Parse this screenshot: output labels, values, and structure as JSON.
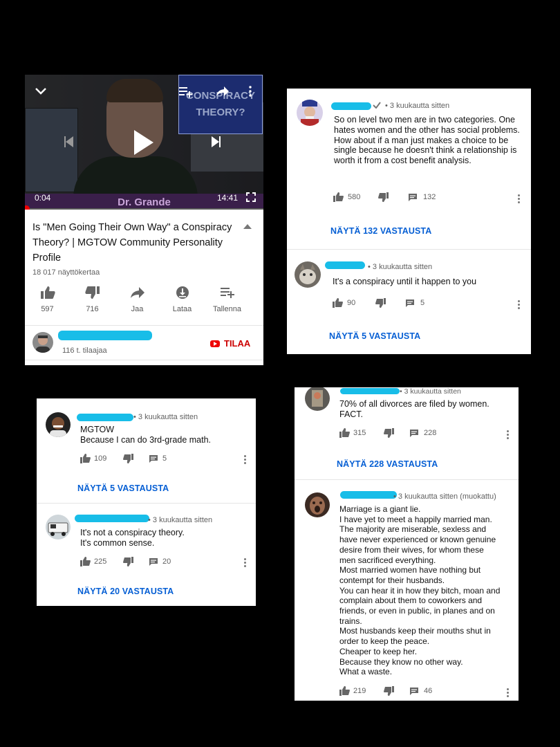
{
  "video": {
    "overlay_text": "CONSPIRACY THEORY?",
    "current_time": "0:04",
    "duration": "14:41",
    "brand": "Dr. Grande",
    "progress": 0.005,
    "title": "Is \"Men Going Their Own Way\" a Conspiracy Theory? | MGTOW Community Personality Profile",
    "views": "18 017 näyttökertaa",
    "actions": [
      {
        "label": "597",
        "icon": "thumbs-up-icon"
      },
      {
        "label": "716",
        "icon": "thumbs-down-icon"
      },
      {
        "label": "Jaa",
        "icon": "share-icon"
      },
      {
        "label": "Lataa",
        "icon": "download-icon"
      },
      {
        "label": "Tallenna",
        "icon": "playlist-add-icon"
      }
    ],
    "channel": {
      "subscribers": "116 t. tilaajaa",
      "subscribe_label": "TILAA"
    }
  },
  "comments": [
    {
      "time": "• 3 kuukautta sitten",
      "text": "So on level two men are in two categories. One hates women and the other has social problems. How about if a man just makes a choice to be single because he doesn't think a relationship is worth it from a cost benefit analysis.",
      "likes": "580",
      "reply_count": "132",
      "replies_label": "NÄYTÄ 132 VASTAUSTA"
    },
    {
      "time": "• 3 kuukautta sitten",
      "text": "It's a conspiracy until it happen to you",
      "likes": "90",
      "reply_count": "5",
      "replies_label": "NÄYTÄ 5 VASTAUSTA"
    },
    {
      "time": "• 3 kuukautta sitten",
      "text_lines": [
        "MGTOW",
        "Because I can do 3rd-grade math."
      ],
      "likes": "109",
      "reply_count": "5",
      "replies_label": "NÄYTÄ 5 VASTAUSTA"
    },
    {
      "time": "• 3 kuukautta sitten",
      "text_lines": [
        "It's not a conspiracy theory.",
        "It's common sense."
      ],
      "likes": "225",
      "reply_count": "20",
      "replies_label": "NÄYTÄ 20 VASTAUSTA"
    },
    {
      "time": "• 3 kuukautta sitten",
      "text_lines": [
        "70% of all divorces are filed by women.",
        "FACT."
      ],
      "likes": "315",
      "reply_count": "228",
      "replies_label": "NÄYTÄ 228 VASTAUSTA"
    },
    {
      "time": "• 3 kuukautta sitten (muokattu)",
      "text_lines": [
        "Marriage is a giant lie.",
        "I have yet to meet a happily married man.",
        "The majority are miserable, sexless and",
        "have never experienced or known genuine",
        "desire from their wives, for whom these",
        "men sacrificed everything.",
        "Most married women have nothing but",
        "contempt for their husbands.",
        "You can hear it in how they bitch, moan and",
        "complain about them to coworkers and",
        "friends, or even in public, in planes and on",
        "trains.",
        "Most husbands keep their mouths shut in",
        "order to keep the peace.",
        "Cheaper to keep her.",
        "Because they know no other way.",
        "What a waste."
      ],
      "likes": "219",
      "reply_count": "46"
    }
  ],
  "colors": {
    "accent_blue": "#065fd4",
    "redaction": "#18bde8",
    "subscribe_red": "#cc0000"
  }
}
